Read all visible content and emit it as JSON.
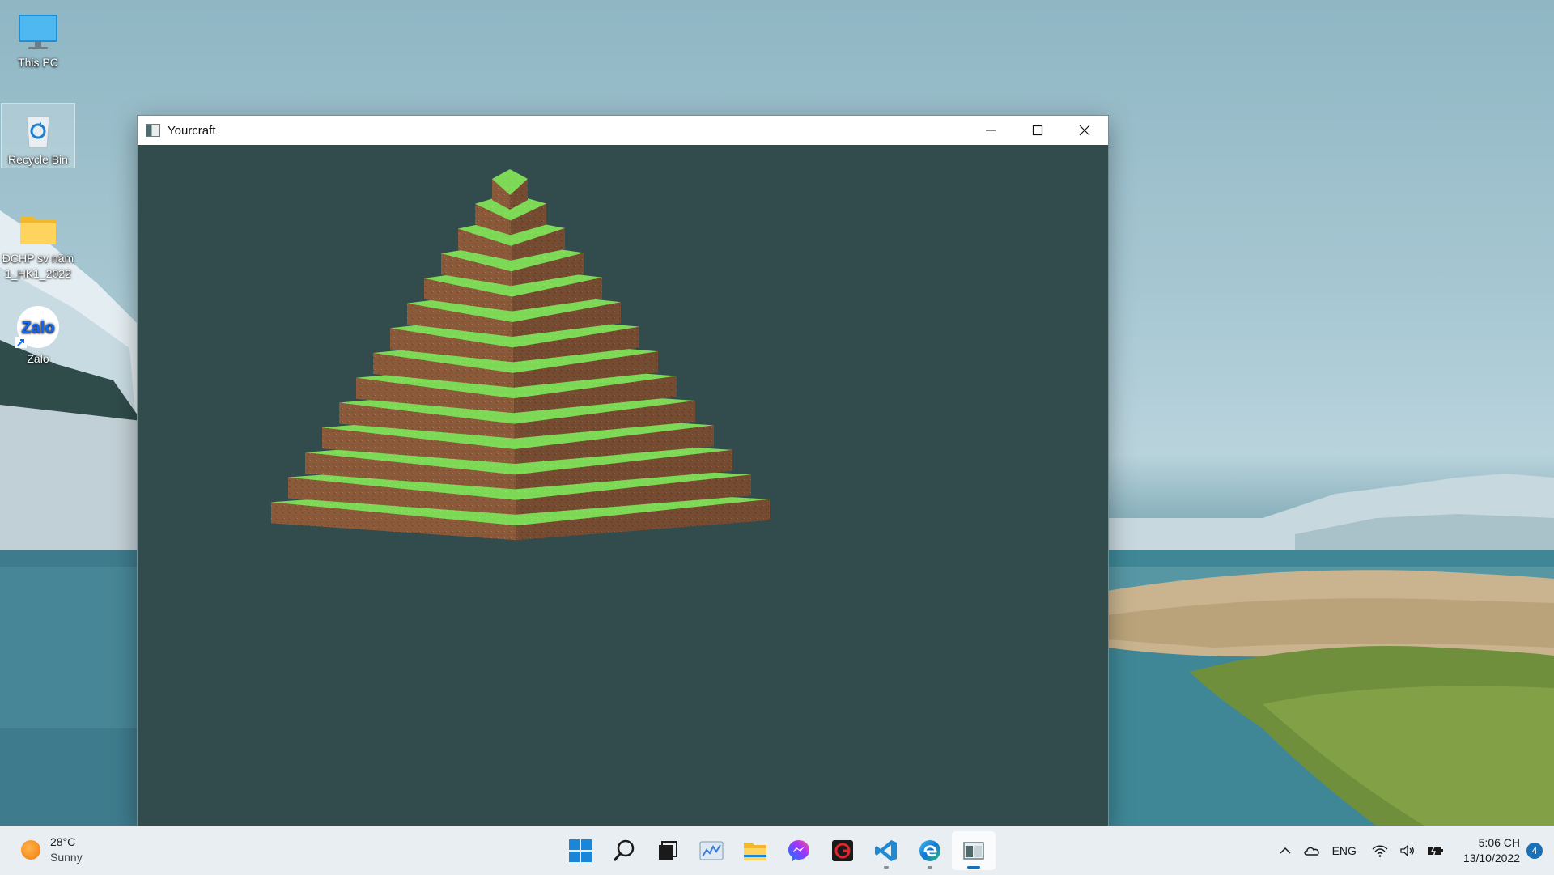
{
  "desktop": {
    "icons": [
      {
        "label": "This PC",
        "icon": "monitor-icon"
      },
      {
        "label": "Recycle Bin",
        "icon": "recycle-bin-icon",
        "selected": true
      },
      {
        "label": "ĐCHP sv năm 1_HK1_2022",
        "icon": "folder-icon"
      },
      {
        "label": "Zalo",
        "icon": "zalo-icon",
        "badge": "Zalo"
      }
    ]
  },
  "window": {
    "title": "Yourcraft",
    "buttons": [
      "minimize",
      "maximize",
      "close"
    ],
    "scene": {
      "description_color_background": "#324c4e",
      "colors": {
        "grass": "#7ed957",
        "grass_dark": "#5fb93a",
        "dirt": "#8a5a3b",
        "dirt_dark": "#6b4128"
      }
    }
  },
  "taskbar": {
    "weather": {
      "temp": "28°C",
      "condition": "Sunny"
    },
    "apps": [
      {
        "name": "start",
        "icon": "windows-start-icon"
      },
      {
        "name": "search",
        "icon": "search-icon"
      },
      {
        "name": "task-view",
        "icon": "task-view-icon"
      },
      {
        "name": "widgets",
        "icon": "chart-app-icon"
      },
      {
        "name": "file-explorer",
        "icon": "folder-icon"
      },
      {
        "name": "messenger",
        "icon": "messenger-icon"
      },
      {
        "name": "garena",
        "icon": "garena-icon"
      },
      {
        "name": "vscode",
        "icon": "vscode-icon",
        "running": true
      },
      {
        "name": "edge",
        "icon": "edge-icon",
        "running": true
      },
      {
        "name": "yourcraft",
        "icon": "yourcraft-app-icon",
        "active": true
      }
    ],
    "tray": {
      "language": "ENG",
      "time": "5:06 CH",
      "date": "13/10/2022",
      "notifications": "4"
    }
  }
}
